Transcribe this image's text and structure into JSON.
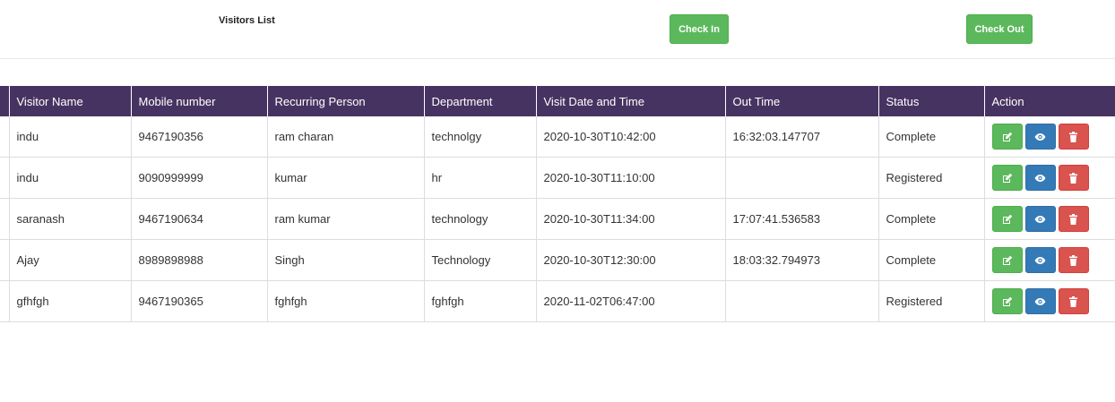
{
  "header": {
    "title": "Visitors List",
    "check_in_label": "Check In",
    "check_out_label": "Check Out"
  },
  "colors": {
    "header_bg": "#473362",
    "edit": "#5cb85c",
    "view": "#337ab7",
    "delete": "#d9534f"
  },
  "table": {
    "columns": [
      "Visitor Name",
      "Mobile number",
      "Recurring Person",
      "Department",
      "Visit Date and Time",
      "Out Time",
      "Status",
      "Action"
    ],
    "rows": [
      {
        "name": "indu",
        "mobile": "9467190356",
        "person": "ram charan",
        "department": "technolgy",
        "visit": "2020-10-30T10:42:00",
        "out": "16:32:03.147707",
        "status": "Complete"
      },
      {
        "name": "indu",
        "mobile": "9090999999",
        "person": "kumar",
        "department": "hr",
        "visit": "2020-10-30T11:10:00",
        "out": "",
        "status": "Registered"
      },
      {
        "name": "saranash",
        "mobile": "9467190634",
        "person": "ram kumar",
        "department": "technology",
        "visit": "2020-10-30T11:34:00",
        "out": "17:07:41.536583",
        "status": "Complete"
      },
      {
        "name": "Ajay",
        "mobile": "8989898988",
        "person": "Singh",
        "department": "Technology",
        "visit": "2020-10-30T12:30:00",
        "out": "18:03:32.794973",
        "status": "Complete"
      },
      {
        "name": "gfhfgh",
        "mobile": "9467190365",
        "person": "fghfgh",
        "department": "fghfgh",
        "visit": "2020-11-02T06:47:00",
        "out": "",
        "status": "Registered"
      }
    ],
    "action_icons": [
      "edit-icon",
      "eye-icon",
      "trash-icon"
    ]
  }
}
